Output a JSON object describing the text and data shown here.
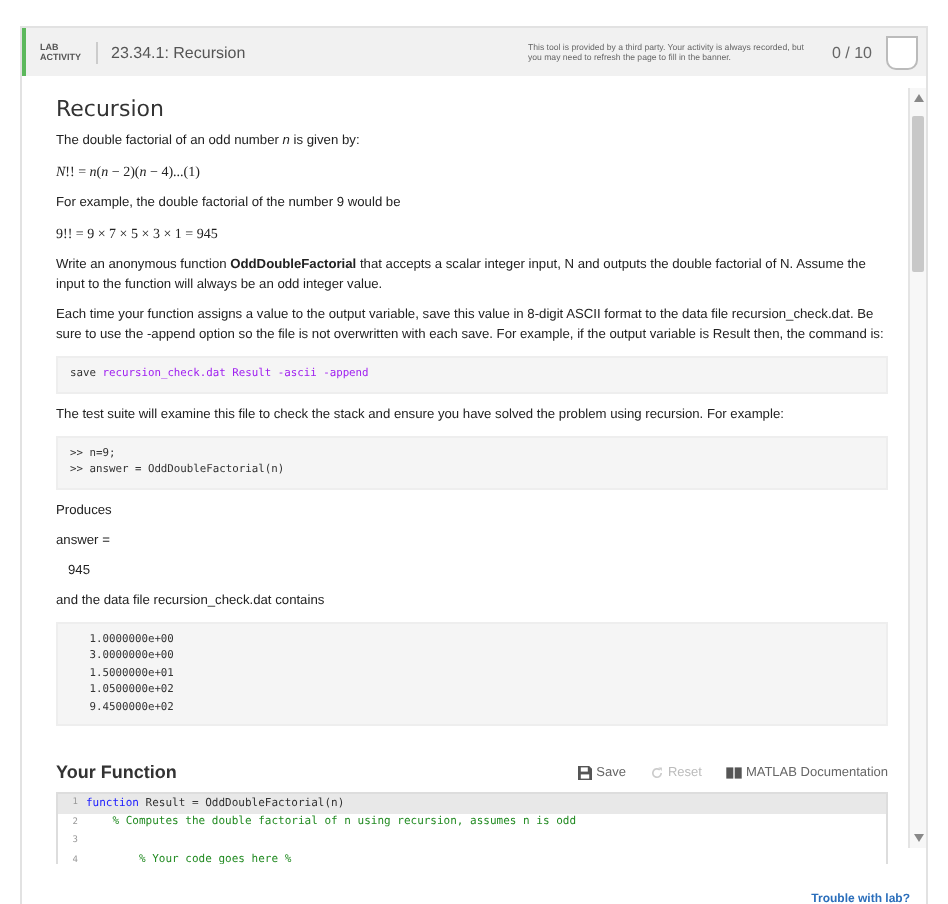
{
  "header": {
    "badge_lines": [
      "LAB",
      "ACTIVITY"
    ],
    "title": "23.34.1: Recursion",
    "notice": "This tool is provided by a third party. Your activity is always recorded, but you may need to refresh the page to fill in the banner.",
    "score": "0 / 10"
  },
  "problem": {
    "heading": "Recursion",
    "blocks": [
      {
        "kind": "text",
        "text": "The double factorial of an odd number *n* is given by:"
      },
      {
        "kind": "math",
        "text": "*N*!! = *n*(*n* − 2)(*n* − 4)...(1)"
      },
      {
        "kind": "text",
        "text": "For example, the double factorial of the number 9 would be"
      },
      {
        "kind": "math",
        "text": "9!! = 9 × 7 × 5 × 3 × 1 = 945"
      },
      {
        "kind": "text",
        "text": "Write an anonymous function **OddDoubleFactorial** that accepts a scalar integer input, N and outputs the double factorial of N.  Assume the input to the function will always be an odd integer value."
      },
      {
        "kind": "text",
        "text": "Each time your function assigns a value to the output variable, save this  value in 8-digit ASCII format to the data file recursion_check.dat. Be sure to use the -append option so the file is not overwritten with each save.  For example, if the output variable is Result then, the command is:"
      },
      {
        "kind": "code",
        "lines": [
          [
            {
              "kind": "plain",
              "text": "save "
            },
            {
              "kind": "string",
              "text": "recursion_check.dat Result -ascii -append"
            }
          ]
        ]
      },
      {
        "kind": "text",
        "text": "The test suite will examine this file to check the stack and ensure you have solved the problem using recursion.  For example:"
      },
      {
        "kind": "code",
        "lines": [
          [
            {
              "kind": "plain",
              "text": ">> n=9;"
            }
          ],
          [
            {
              "kind": "plain",
              "text": ">> answer = OddDoubleFactorial(n)"
            }
          ]
        ]
      },
      {
        "kind": "text",
        "text": "Produces"
      },
      {
        "kind": "text",
        "text": "answer ="
      },
      {
        "kind": "indent",
        "text": "945"
      },
      {
        "kind": "text",
        "text": "and the data file recursion_check.dat contains"
      },
      {
        "kind": "code",
        "lines": [
          [
            {
              "kind": "plain",
              "text": "   1.0000000e+00"
            }
          ],
          [
            {
              "kind": "plain",
              "text": "   3.0000000e+00"
            }
          ],
          [
            {
              "kind": "plain",
              "text": "   1.5000000e+01"
            }
          ],
          [
            {
              "kind": "plain",
              "text": "   1.0500000e+02"
            }
          ],
          [
            {
              "kind": "plain",
              "text": "   9.4500000e+02"
            }
          ]
        ]
      }
    ]
  },
  "editor": {
    "heading": "Your Function",
    "tools": [
      {
        "kind": "save",
        "label": "Save",
        "disabled": false
      },
      {
        "kind": "reset",
        "label": "Reset",
        "disabled": true
      },
      {
        "kind": "docs",
        "label": "MATLAB Documentation",
        "disabled": false
      }
    ],
    "lines": [
      {
        "number": "1",
        "highlighted": true,
        "segments": [
          {
            "kind": "keyword",
            "text": "function"
          },
          {
            "kind": "plain",
            "text": " Result = OddDoubleFactorial(n)"
          }
        ]
      },
      {
        "number": "2",
        "highlighted": false,
        "segments": [
          {
            "kind": "comment",
            "text": "    % Computes the double factorial of n using recursion, assumes n is odd"
          }
        ]
      },
      {
        "number": "3",
        "highlighted": false
      },
      {
        "number": "4",
        "highlighted": false,
        "segments": [
          {
            "kind": "comment",
            "text": "        % Your code goes here %"
          }
        ]
      }
    ]
  },
  "footer": {
    "link": "Trouble with lab?"
  }
}
